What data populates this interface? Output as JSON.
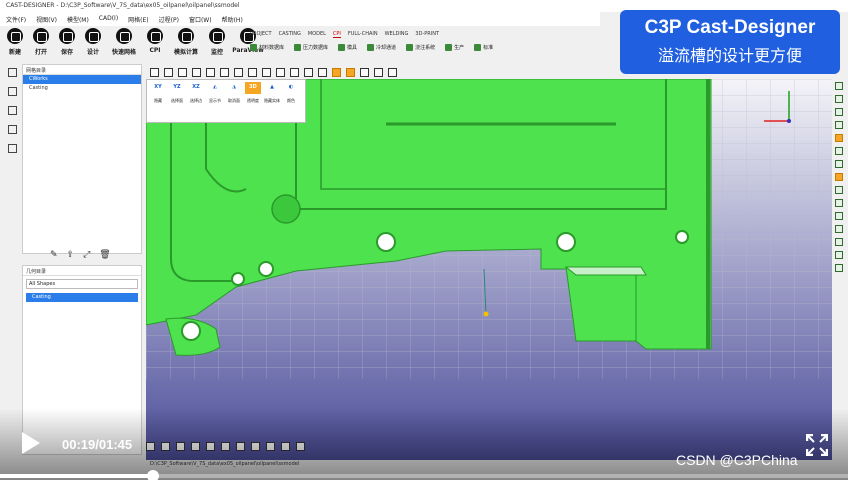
{
  "window": {
    "title": "CAST-DESIGNER - D:\\C3P_Software\\V_7S_data\\ex05_oilpanel\\oilpanel\\ssmodel"
  },
  "menu": [
    "文件(F)",
    "视图(V)",
    "模型(M)",
    "CAD(I)",
    "网格(E)",
    "过程(P)",
    "窗口(W)",
    "帮助(H)"
  ],
  "ribbon": {
    "buttons": [
      {
        "label": "新建",
        "icon": "new-file-icon"
      },
      {
        "label": "打开",
        "icon": "open-folder-icon"
      },
      {
        "label": "保存",
        "icon": "save-icon"
      },
      {
        "label": "设计",
        "icon": "design-icon"
      },
      {
        "label": "快速网格",
        "icon": "quick-mesh-icon"
      },
      {
        "label": "CPI",
        "icon": "cpi-icon"
      },
      {
        "label": "模拟计算",
        "icon": "simulation-icon"
      },
      {
        "label": "监控",
        "icon": "monitor-icon"
      },
      {
        "label": "ParaView",
        "icon": "paraview-icon"
      }
    ],
    "tabs": [
      "PROJECT",
      "CASTING",
      "MODEL",
      "CPI",
      "FULL-CHAIN",
      "WELDING",
      "3D-PRINT"
    ],
    "active_tab": "CPI",
    "subtools": [
      "材料数据库",
      "压力数据库",
      "模具",
      "冷却通道",
      "浇注系统",
      "生产",
      "标准"
    ]
  },
  "banner": {
    "title": "C3P Cast-Designer",
    "subtitle": "溢流槽的设计更方便"
  },
  "tree_panel": {
    "header": "网格目录",
    "items": [
      {
        "label": "CWorks",
        "selected": true
      },
      {
        "label": "Casting",
        "selected": false
      }
    ]
  },
  "geometry_panel": {
    "header": "几何目录",
    "selector": "All Shapes",
    "items": [
      {
        "label": "Casting",
        "selected": true
      }
    ]
  },
  "view_palette": {
    "view_buttons": [
      "XY",
      "YZ",
      "XZ",
      "",
      "",
      "3D",
      "",
      ""
    ],
    "active": "3D",
    "labels": [
      "隐藏",
      "选择面",
      "选择边",
      "显示节",
      "取消面",
      "透明度",
      "隐藏实体",
      "颜色"
    ]
  },
  "video": {
    "time": "00:19/01:45",
    "progress": 0.181,
    "watermark": "CSDN @C3PChina"
  },
  "status_path": "D:\\C3P_Software\\V_7S_data\\ex05_oilpanel\\oilpanel\\ssmodel",
  "colors": {
    "banner": "#1f5fe0",
    "mesh_part": "#4fe24f",
    "highlight": "#f5a623",
    "selection": "#2b7de9"
  }
}
